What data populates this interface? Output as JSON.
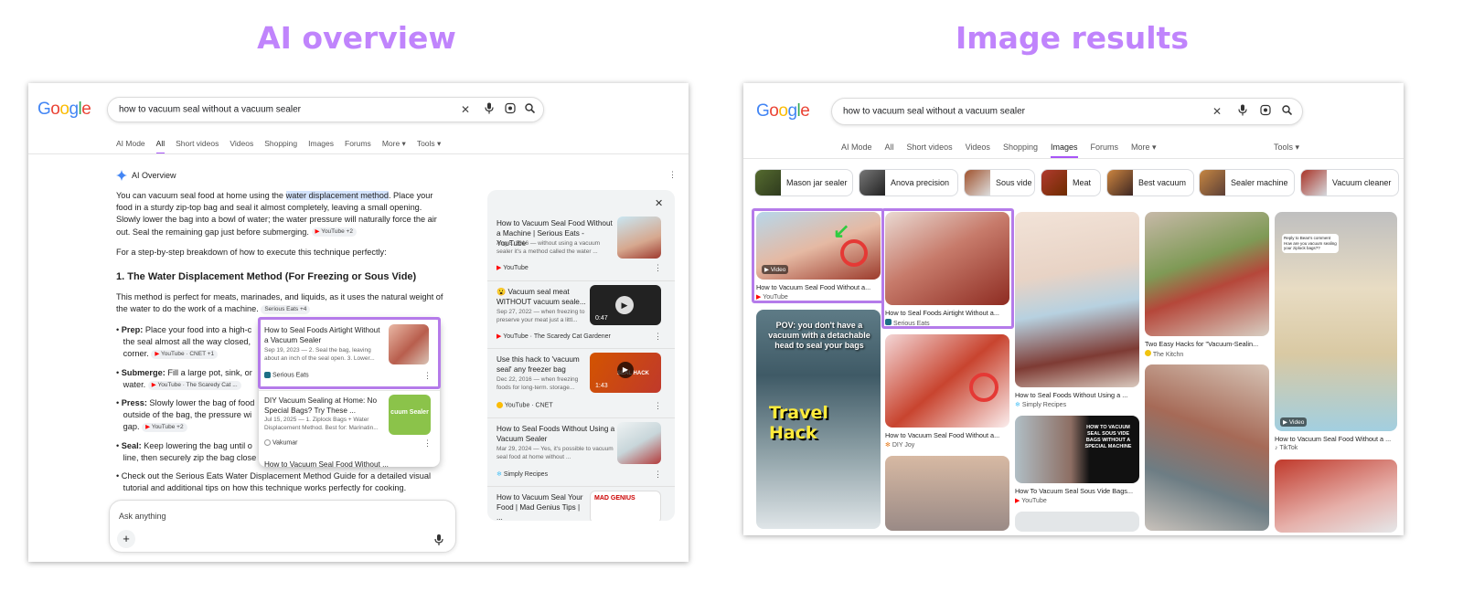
{
  "headings": {
    "left": "AI overview",
    "right": "Image results"
  },
  "colors": {
    "accent": "#a855f7",
    "heading": "#c084fc",
    "youtube": "#ff0000"
  },
  "left": {
    "logo": "Google",
    "query": "how to vacuum seal without a vacuum sealer",
    "tabs": [
      "AI Mode",
      "All",
      "Short videos",
      "Videos",
      "Shopping",
      "Images",
      "Forums",
      "More ▾",
      "Tools ▾"
    ],
    "active_tab": "All",
    "ai_overview_label": "AI Overview",
    "intro_pre": "You can vacuum seal food at home using the ",
    "intro_highlight": "water displacement method",
    "intro_post": ". Place your food in a sturdy zip-top bag and seal it almost completely, leaving a small opening. Slowly lower the bag into a bowl of water; the water pressure will naturally force the air out. Seal the remaining gap just before submerging.",
    "intro_chip": "YouTube +2",
    "breakdown": "For a step-by-step breakdown of how to execute this technique perfectly:",
    "section_title": "1. The Water Displacement Method (For Freezing or Sous Vide)",
    "section_text": "This method is perfect for meats, marinades, and liquids, as it uses the natural weight of the water to do the work of a machine.",
    "section_chip": "Serious Eats +4",
    "bullets": [
      {
        "term": "Prep:",
        "text": " Place your food into a high-c",
        "cont": "the seal almost all the way closed,",
        "cont2": "corner.",
        "chip": "YouTube · CNET +1"
      },
      {
        "term": "Submerge:",
        "text": " Fill a large pot, sink, or",
        "cont": "water.",
        "chip": "YouTube · The Scaredy Cat ..."
      },
      {
        "term": "Press:",
        "text": " Slowly lower the bag of food",
        "cont": "outside of the bag, the pressure wi",
        "cont2": "gap.",
        "chip": "YouTube +2"
      },
      {
        "term": "Seal:",
        "text": " Keep lowering the bag until o",
        "cont": "line, then securely zip the bag close"
      },
      {
        "term": "",
        "text": "Check out the Serious Eats Water Displacement Method Guide for a detailed visual",
        "cont": "tutorial and additional tips on how this technique works perfectly for cooking."
      }
    ],
    "popup": [
      {
        "title": "How to Seal Foods Airtight Without a Vacuum Sealer",
        "desc": "Sep 19, 2023 — 2. Seal the bag, leaving about an inch of the seal open. 3. Lower...",
        "site": "Serious Eats"
      },
      {
        "title": "DIY Vacuum Sealing at Home: No Special Bags? Try These ...",
        "desc": "Jul 15, 2025 — 1. Ziplock Bags + Water Displacement Method. Best for: Marinatin...",
        "site": "Vakumar",
        "thumb_text": "cuum Sealer"
      },
      {
        "title": "How to Vacuum Seal Food Without ..."
      }
    ],
    "sources": [
      {
        "title": "How to Vacuum Seal Food Without a Machine | Serious Eats - YouTube",
        "desc": "Aug 8, 2016 — without using a vacuum sealer it's a method called the water ...",
        "site": "YouTube"
      },
      {
        "title": "😮 Vacuum seal meat WITHOUT vacuum seale...",
        "desc": "Sep 27, 2022 — when freezing to preserve your meat just a littl...",
        "site": "YouTube · The Scaredy Cat Gardener",
        "duration": "0:47"
      },
      {
        "title": "Use this hack to 'vacuum seal' any freezer bag",
        "desc": "Dec 22, 2016 — when freezing foods for long-term. storage...",
        "site": "YouTube · CNET",
        "duration": "1:43",
        "thumb_text": "SEAL HACK"
      },
      {
        "title": "How to Seal Foods Without Using a Vacuum Sealer",
        "desc": "Mar 29, 2024 — Yes, it's possible to vacuum seal food at home without ...",
        "site": "Simply Recipes"
      },
      {
        "title": "How to Vacuum Seal Your Food | Mad Genius Tips | ...",
        "thumb_text": "MAD GENIUS"
      }
    ],
    "ask_placeholder": "Ask anything"
  },
  "right": {
    "logo": "Google",
    "query": "how to vacuum seal without a vacuum sealer",
    "tabs": [
      "AI Mode",
      "All",
      "Short videos",
      "Videos",
      "Shopping",
      "Images",
      "Forums",
      "More ▾"
    ],
    "active_tab": "Images",
    "tools": "Tools ▾",
    "chips": [
      "Mason jar sealer",
      "Anova precision",
      "Sous vide",
      "Meat",
      "Best vacuum",
      "Sealer machine",
      "Vacuum cleaner"
    ],
    "results": [
      {
        "caption": "How to Vacuum Seal Food Without a...",
        "source": "YouTube",
        "badge": "Video"
      },
      {
        "overlay_top": "POV: you don't have a vacuum with a detachable head to seal your bags",
        "overlay_big": "Travel Hack"
      },
      {
        "caption": "How to Seal Foods Airtight Without a...",
        "source": "Serious Eats"
      },
      {
        "caption": "How to Vacuum Seal Food Without a...",
        "source": "DIY Joy"
      },
      {
        "caption": "How to Seal Foods Without Using a ...",
        "source": "Simply Recipes"
      },
      {
        "caption": "How To Vacuum Seal Sous Vide Bags...",
        "source": "YouTube",
        "overlay": "HOW TO VACUUM SEAL SOUS VIDE BAGS WITHOUT A SPECIAL MACHINE"
      },
      {
        "caption": "Two Easy Hacks for \"Vacuum-Sealin...",
        "source": "The Kitchn"
      },
      {
        "caption": "How to Vacuum Seal Food Without a ...",
        "source": "TikTok",
        "badge": "Video",
        "bubble": "Reply to Bean's comment How are you vacuum sealing your ziplock bags??"
      }
    ]
  }
}
